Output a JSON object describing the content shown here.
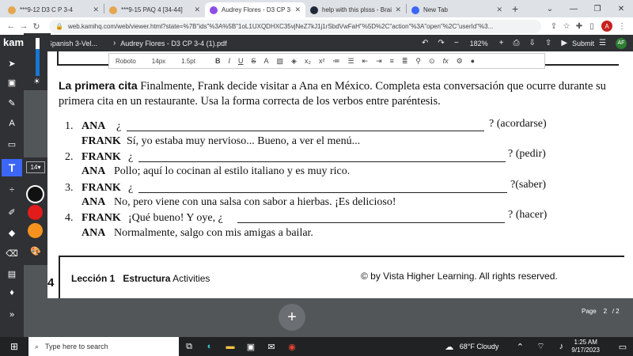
{
  "browser": {
    "tabs": [
      {
        "title": "***9-12 D3 C P 3-4",
        "color": "#e5a650"
      },
      {
        "title": "***9-15 PAQ 4 [34-44]",
        "color": "#e5a650"
      },
      {
        "title": "Audrey Flores - D3 CP 3-4 (1)",
        "color": "#8d4ee6"
      },
      {
        "title": "help with this plsss - Brainly",
        "color": "#1f2937"
      },
      {
        "title": "New Tab",
        "color": "#3c67f6"
      }
    ],
    "url": "web.kamihq.com/web/viewer.html?state=%7B\"ids\"%3A%5B\"1oL1UXQDHXC35vjNeZ7kJ1j1rSbdVwFaH\"%5D%2C\"action\"%3A\"open\"%2C\"userId\"%3..."
  },
  "kami": {
    "breadcrumb_folder": "Spanish 3-Vel...",
    "doc_title": "Audrey Flores - D3 CP 3-4 (1).pdf",
    "zoom": "182%",
    "submit_label": "Submit",
    "user_initials": "AF",
    "font_family": "Roboto",
    "font_size": "14px",
    "line_height": "1.5pt",
    "text_size_select": "14",
    "logo": "kami"
  },
  "colors": {
    "accent": "#3c67f6",
    "swatches": [
      "#111111",
      "#e21b1b",
      "#f5931e"
    ]
  },
  "document": {
    "section_title": "La primera cita",
    "instructions": "Finalmente, Frank decide visitar a Ana en México. Completa esta conversación que ocurre durante su primera cita en un restaurante. Usa la forma correcta de los verbos entre paréntesis.",
    "items": [
      {
        "num": "1.",
        "speaker": "ANA",
        "prefix": "¿",
        "suffix": "? (acordarse)",
        "reply_speaker": "FRANK",
        "reply": "Sí, yo estaba muy nervioso... Bueno, a ver el menú..."
      },
      {
        "num": "2.",
        "speaker": "FRANK",
        "prefix": "¿",
        "suffix": "? (pedir)",
        "reply_speaker": "ANA",
        "reply": "Pollo; aquí lo cocinan al estilo italiano y es muy rico."
      },
      {
        "num": "3.",
        "speaker": "FRANK",
        "prefix": "¿",
        "suffix": "?(saber)",
        "reply_speaker": "ANA",
        "reply": "No, pero viene con una salsa con sabor a hierbas. ¡Es delicioso!"
      },
      {
        "num": "4.",
        "speaker": "FRANK",
        "prefix": "¡Qué bueno! Y oye, ¿",
        "suffix": "? (hacer)",
        "reply_speaker": "ANA",
        "reply": "Normalmente, salgo con mis amigas a bailar."
      }
    ],
    "footer": {
      "page_number": "4",
      "lesson": "Lección 1",
      "section": "Estructura",
      "activity": "Activities",
      "rights": "© by Vista Higher Learning. All rights reserved."
    }
  },
  "page_nav": {
    "label": "Page",
    "current": "2",
    "total": "/ 2"
  },
  "taskbar": {
    "search_placeholder": "Type here to search",
    "weather": "68°F  Cloudy",
    "time": "1:25 AM",
    "date": "9/17/2023"
  }
}
